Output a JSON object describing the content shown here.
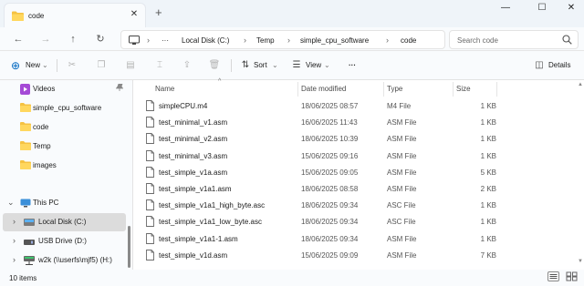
{
  "window": {
    "tab_title": "code",
    "tab_close_glyph": "✕",
    "new_tab_glyph": "+",
    "minimize_glyph": "—",
    "maximize_glyph": "☐",
    "close_glyph": "✕"
  },
  "nav": {
    "back_glyph": "←",
    "forward_glyph": "→",
    "up_glyph": "↑",
    "refresh_glyph": "↻",
    "more_glyph": "···",
    "separator_glyph": "›",
    "breadcrumbs": [
      "Local Disk (C:)",
      "Temp",
      "simple_cpu_software",
      "code"
    ],
    "search_placeholder": "Search code"
  },
  "toolbar": {
    "new_label": "New",
    "sort_label": "Sort",
    "view_label": "View",
    "more_glyph": "···",
    "details_label": "Details",
    "dropdown_glyph": "⌄"
  },
  "sidebar": {
    "items": [
      {
        "label": "Videos",
        "icon": "videos-icon",
        "pinned": true
      },
      {
        "label": "simple_cpu_software",
        "icon": "folder-icon"
      },
      {
        "label": "code",
        "icon": "folder-icon"
      },
      {
        "label": "Temp",
        "icon": "folder-icon"
      },
      {
        "label": "images",
        "icon": "folder-icon"
      },
      {
        "label": "This PC",
        "icon": "computer-icon",
        "expanded": true
      },
      {
        "label": "Local Disk (C:)",
        "icon": "drive-icon",
        "selected": true
      },
      {
        "label": "USB Drive (D:)",
        "icon": "usb-drive-icon"
      },
      {
        "label": "w2k (\\\\userfs\\mjf5) (H:)",
        "icon": "network-drive-icon"
      }
    ],
    "pin_glyph": "📌",
    "chevron_right": "›",
    "chevron_down": "⌄"
  },
  "columns": {
    "name": "Name",
    "date": "Date modified",
    "type": "Type",
    "size": "Size",
    "sort_caret": "^"
  },
  "files": [
    {
      "name": "simpleCPU.m4",
      "date": "18/06/2025 08:57",
      "type": "M4 File",
      "size": "1 KB"
    },
    {
      "name": "test_minimal_v1.asm",
      "date": "16/06/2025 11:43",
      "type": "ASM File",
      "size": "1 KB"
    },
    {
      "name": "test_minimal_v2.asm",
      "date": "18/06/2025 10:39",
      "type": "ASM File",
      "size": "1 KB"
    },
    {
      "name": "test_minimal_v3.asm",
      "date": "15/06/2025 09:16",
      "type": "ASM File",
      "size": "1 KB"
    },
    {
      "name": "test_simple_v1a.asm",
      "date": "15/06/2025 09:05",
      "type": "ASM File",
      "size": "5 KB"
    },
    {
      "name": "test_simple_v1a1.asm",
      "date": "18/06/2025 08:58",
      "type": "ASM File",
      "size": "2 KB"
    },
    {
      "name": "test_simple_v1a1_high_byte.asc",
      "date": "18/06/2025 09:34",
      "type": "ASC File",
      "size": "1 KB"
    },
    {
      "name": "test_simple_v1a1_low_byte.asc",
      "date": "18/06/2025 09:34",
      "type": "ASC File",
      "size": "1 KB"
    },
    {
      "name": "test_simple_v1a1-1.asm",
      "date": "18/06/2025 09:34",
      "type": "ASM File",
      "size": "1 KB"
    },
    {
      "name": "test_simple_v1d.asm",
      "date": "15/06/2025 09:09",
      "type": "ASM File",
      "size": "7 KB"
    }
  ],
  "status": {
    "item_count": "10 items"
  },
  "colors": {
    "folder": "#f5c242",
    "accent": "#0067c0",
    "selected_row": "#dcdcdc"
  }
}
